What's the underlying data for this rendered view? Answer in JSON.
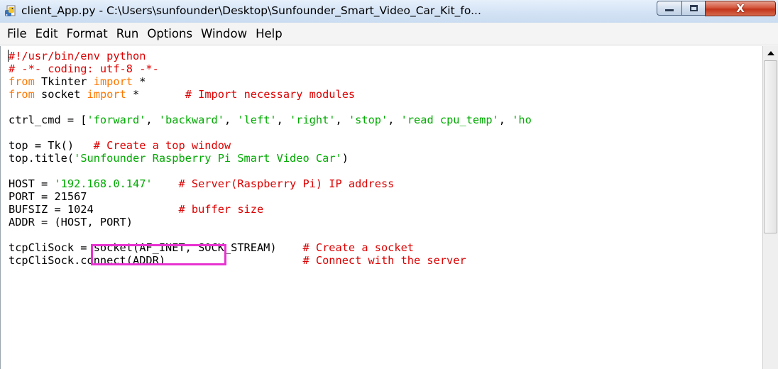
{
  "window": {
    "title": "client_App.py - C:\\Users\\sunfounder\\Desktop\\Sunfounder_Smart_Video_Car_Kit_fo...",
    "close_glyph": "X"
  },
  "menu": [
    "File",
    "Edit",
    "Format",
    "Run",
    "Options",
    "Window",
    "Help"
  ],
  "colors": {
    "keyword": "#ff7700",
    "string": "#00aa00",
    "comment": "#dd0000",
    "highlight_box": "#e832d0"
  },
  "code_lines": [
    [
      {
        "t": "#!/usr/bin/env python",
        "c": "cmt"
      }
    ],
    [
      {
        "t": "# -*- coding: utf-8 -*-",
        "c": "cmt"
      }
    ],
    [
      {
        "t": "from",
        "c": "kw"
      },
      {
        "t": " Tkinter "
      },
      {
        "t": "import",
        "c": "kw"
      },
      {
        "t": " *"
      }
    ],
    [
      {
        "t": "from",
        "c": "kw"
      },
      {
        "t": " socket "
      },
      {
        "t": "import",
        "c": "kw"
      },
      {
        "t": " *       "
      },
      {
        "t": "# Import necessary modules",
        "c": "cmt"
      }
    ],
    [],
    [
      {
        "t": "ctrl_cmd = ["
      },
      {
        "t": "'forward'",
        "c": "str"
      },
      {
        "t": ", "
      },
      {
        "t": "'backward'",
        "c": "str"
      },
      {
        "t": ", "
      },
      {
        "t": "'left'",
        "c": "str"
      },
      {
        "t": ", "
      },
      {
        "t": "'right'",
        "c": "str"
      },
      {
        "t": ", "
      },
      {
        "t": "'stop'",
        "c": "str"
      },
      {
        "t": ", "
      },
      {
        "t": "'read cpu_temp'",
        "c": "str"
      },
      {
        "t": ", "
      },
      {
        "t": "'ho",
        "c": "str"
      }
    ],
    [],
    [
      {
        "t": "top = Tk()   "
      },
      {
        "t": "# Create a top window",
        "c": "cmt"
      }
    ],
    [
      {
        "t": "top.title("
      },
      {
        "t": "'Sunfounder Raspberry Pi Smart Video Car'",
        "c": "str"
      },
      {
        "t": ")"
      }
    ],
    [],
    [
      {
        "t": "HOST = "
      },
      {
        "t": "'192.168.0.147'",
        "c": "str"
      },
      {
        "t": "    "
      },
      {
        "t": "# Server(Raspberry Pi) IP address",
        "c": "cmt"
      }
    ],
    [
      {
        "t": "PORT = 21567"
      }
    ],
    [
      {
        "t": "BUFSIZ = 1024             "
      },
      {
        "t": "# buffer size",
        "c": "cmt"
      }
    ],
    [
      {
        "t": "ADDR = (HOST, PORT)"
      }
    ],
    [],
    [
      {
        "t": "tcpCliSock = socket(AF_INET, SOCK_STREAM)    "
      },
      {
        "t": "# Create a socket",
        "c": "cmt"
      }
    ],
    [
      {
        "t": "tcpCliSock.connect(ADDR)                     "
      },
      {
        "t": "# Connect with the server",
        "c": "cmt"
      }
    ]
  ]
}
